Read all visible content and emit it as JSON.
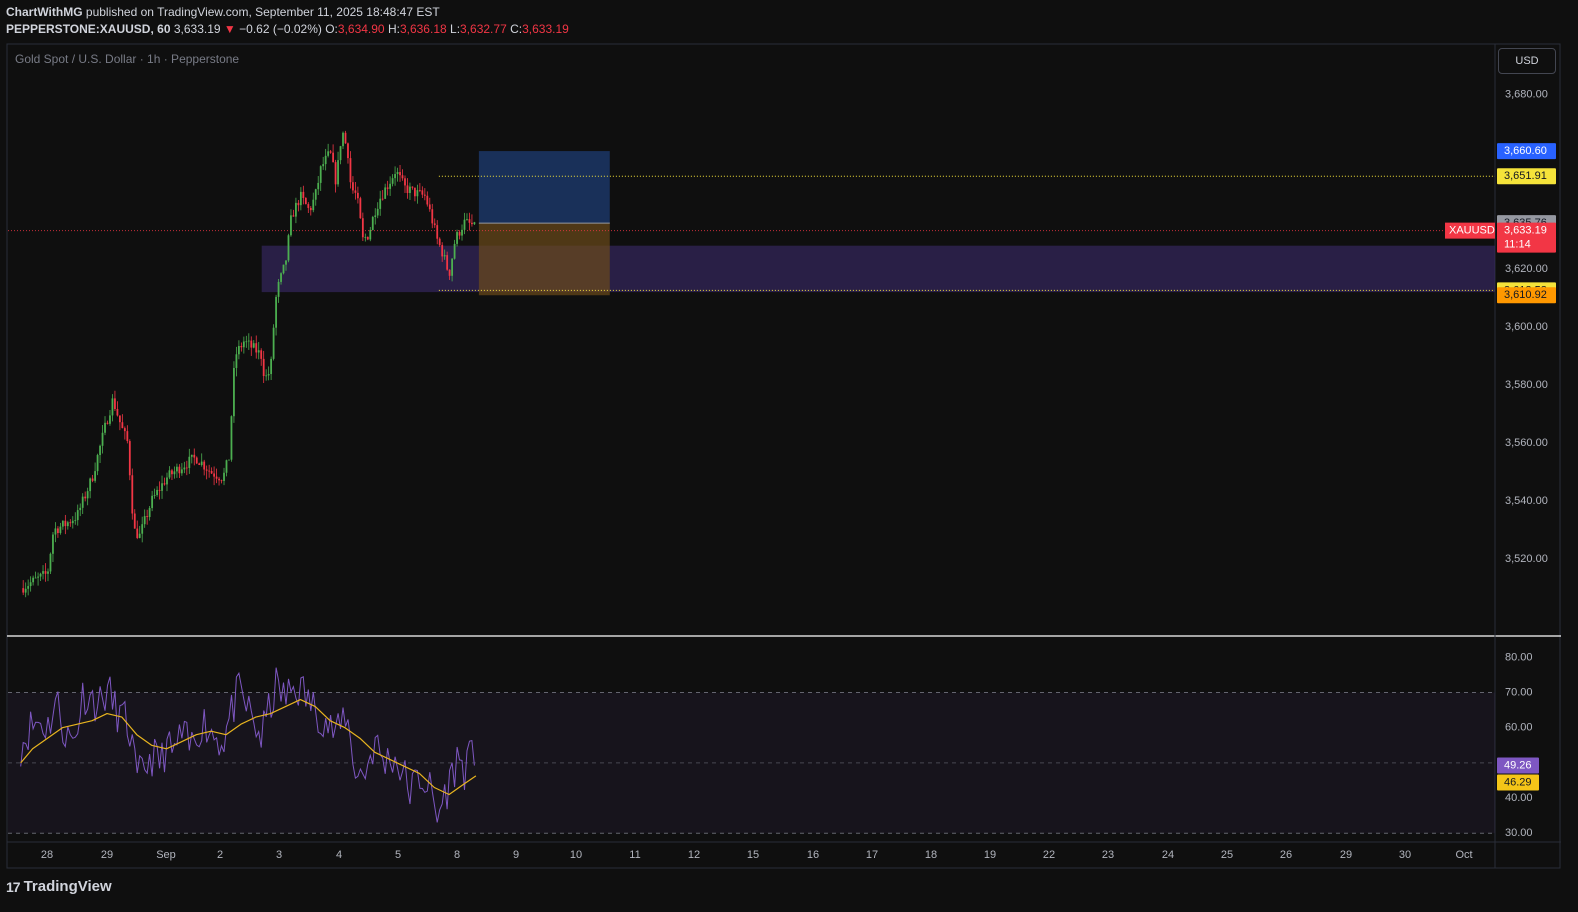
{
  "header": {
    "author": "ChartWithMG",
    "published_text": "published on TradingView.com, September 11, 2025 18:48:47 EST",
    "symbol": "PEPPERSTONE:XAUUSD, 60",
    "last": "3,633.19",
    "change_arrow": "▼",
    "change": "−0.62 (−0.02%)",
    "o_label": "O:",
    "o_value": "3,634.90",
    "h_label": "H:",
    "h_value": "3,636.18",
    "l_label": "L:",
    "l_value": "3,632.77",
    "c_label": "C:",
    "c_value": "3,633.19"
  },
  "currency_button": "USD",
  "brand": {
    "mark": "17",
    "name": "TradingView"
  },
  "colors": {
    "background": "#0f0f0f",
    "up": "#26a69a",
    "up_bright": "#4caf50",
    "down": "#f23645",
    "rsi_line": "#7e57c2",
    "rsi_ma": "#e8b41f",
    "zone": "#3b2a6b",
    "target": "#1b3666",
    "stop": "#6b4a1a"
  },
  "chart_data": [
    {
      "type": "candlestick",
      "title": "Gold Spot / U.S. Dollar · 1h · Pepperstone",
      "y_ticks": [
        "3,520.00",
        "3,540.00",
        "3,560.00",
        "3,580.00",
        "3,600.00",
        "3,620.00",
        "3,680.00"
      ],
      "y_tick_values": [
        3520,
        3540,
        3560,
        3580,
        3600,
        3620,
        3680
      ],
      "ylim": [
        3493.5,
        3697.5
      ],
      "x_tick_labels": [
        "28",
        "29",
        "Sep",
        "2",
        "3",
        "4",
        "5",
        "8",
        "9",
        "10",
        "11",
        "12",
        "15",
        "16",
        "17",
        "18",
        "19",
        "22",
        "23",
        "24",
        "25",
        "26",
        "29",
        "30",
        "Oct"
      ],
      "price_path": [
        [
          -0.45,
          3510
        ],
        [
          0,
          3515
        ],
        [
          0.1,
          3530
        ],
        [
          0.3,
          3532
        ],
        [
          0.5,
          3535
        ],
        [
          0.75,
          3548
        ],
        [
          1,
          3568
        ],
        [
          1.1,
          3575
        ],
        [
          1.25,
          3565
        ],
        [
          1.35,
          3560
        ],
        [
          1.45,
          3530
        ],
        [
          1.55,
          3528
        ],
        [
          1.75,
          3540
        ],
        [
          2,
          3548
        ],
        [
          2.25,
          3552
        ],
        [
          2.5,
          3555
        ],
        [
          2.75,
          3550
        ],
        [
          2.95,
          3548
        ],
        [
          3.05,
          3555
        ],
        [
          3.15,
          3590
        ],
        [
          3.3,
          3595
        ],
        [
          3.5,
          3592
        ],
        [
          3.6,
          3590
        ],
        [
          3.65,
          3582
        ],
        [
          3.75,
          3585
        ],
        [
          3.8,
          3600
        ],
        [
          3.85,
          3612
        ],
        [
          4,
          3622
        ],
        [
          4.1,
          3638
        ],
        [
          4.25,
          3645
        ],
        [
          4.4,
          3640
        ],
        [
          4.5,
          3645
        ],
        [
          4.6,
          3655
        ],
        [
          4.75,
          3660
        ],
        [
          4.85,
          3650
        ],
        [
          4.95,
          3668
        ],
        [
          5.05,
          3660
        ],
        [
          5.1,
          3648
        ],
        [
          5.2,
          3645
        ],
        [
          5.3,
          3630
        ],
        [
          5.4,
          3632
        ],
        [
          5.5,
          3640
        ],
        [
          5.6,
          3645
        ],
        [
          5.75,
          3650
        ],
        [
          5.85,
          3654
        ],
        [
          6,
          3648
        ],
        [
          6.2,
          3646
        ],
        [
          6.35,
          3645
        ],
        [
          6.45,
          3638
        ],
        [
          6.55,
          3630
        ],
        [
          6.65,
          3625
        ],
        [
          6.75,
          3618
        ],
        [
          6.85,
          3630
        ],
        [
          7,
          3636
        ],
        [
          7.15,
          3635
        ],
        [
          7.2,
          3633.19
        ]
      ],
      "last_price": 3633.19,
      "price_labels": [
        {
          "text": "3,660.60",
          "value": 3660.6,
          "bg": "#2962ff",
          "fg": "#ffffff"
        },
        {
          "text": "3,651.91",
          "value": 3651.91,
          "bg": "#f5e33a",
          "fg": "#131722"
        },
        {
          "text": "3,635.76",
          "value": 3635.76,
          "bg": "#9598a1",
          "fg": "#131722"
        },
        {
          "text": "3,633.19",
          "value": 3633.19,
          "bg": "#f23645",
          "fg": "#ffffff"
        },
        {
          "text": "11:14",
          "value": 3633.19,
          "bg": "#f23645",
          "fg": "#ffffff"
        },
        {
          "text": "3,612.58",
          "value": 3612.58,
          "bg": "#f5e33a",
          "fg": "#131722"
        },
        {
          "text": "3,610.92",
          "value": 3610.92,
          "bg": "#ff9800",
          "fg": "#131722"
        }
      ],
      "symbol_tag": "XAUUSD",
      "demand_zone": {
        "from_day": 3.6,
        "to_day": 24.3,
        "low": 3612,
        "high": 3628
      },
      "position": {
        "from_day": 7.25,
        "to_day": 9.45,
        "target": 3660.6,
        "entry": 3635.76,
        "stop": 3610.92
      },
      "levels": [
        {
          "value": 3651.91,
          "from_day": 7.25,
          "color": "#f5e33a"
        },
        {
          "value": 3612.58,
          "from_day": 7.25,
          "color": "#f5e33a"
        }
      ]
    },
    {
      "type": "line",
      "title": "",
      "y_ticks": [
        "30.00",
        "40.00",
        "60.00",
        "70.00",
        "80.00"
      ],
      "y_tick_values": [
        30,
        40,
        60,
        70,
        80
      ],
      "ylim": [
        27.5,
        85.5
      ],
      "bands": {
        "upper": 70,
        "middle": 50,
        "lower": 30
      },
      "rsi_path": [
        [
          -0.45,
          55
        ],
        [
          -0.3,
          60
        ],
        [
          -0.15,
          62
        ],
        [
          0,
          60
        ],
        [
          0.15,
          68
        ],
        [
          0.3,
          58
        ],
        [
          0.45,
          56
        ],
        [
          0.6,
          70
        ],
        [
          0.75,
          68
        ],
        [
          0.9,
          67
        ],
        [
          1,
          71
        ],
        [
          1.15,
          65
        ],
        [
          1.3,
          62
        ],
        [
          1.4,
          58
        ],
        [
          1.5,
          44
        ],
        [
          1.6,
          48
        ],
        [
          1.75,
          52
        ],
        [
          1.9,
          50
        ],
        [
          2,
          55
        ],
        [
          2.1,
          52
        ],
        [
          2.25,
          58
        ],
        [
          2.4,
          54
        ],
        [
          2.6,
          62
        ],
        [
          2.8,
          58
        ],
        [
          2.95,
          56
        ],
        [
          3.05,
          62
        ],
        [
          3.2,
          70
        ],
        [
          3.35,
          66
        ],
        [
          3.5,
          60
        ],
        [
          3.6,
          57
        ],
        [
          3.7,
          64
        ],
        [
          3.85,
          72
        ],
        [
          4,
          68
        ],
        [
          4.15,
          72
        ],
        [
          4.3,
          70
        ],
        [
          4.45,
          66
        ],
        [
          4.6,
          64
        ],
        [
          4.75,
          60
        ],
        [
          4.9,
          58
        ],
        [
          5,
          65
        ],
        [
          5.1,
          56
        ],
        [
          5.2,
          46
        ],
        [
          5.35,
          48
        ],
        [
          5.5,
          56
        ],
        [
          5.65,
          50
        ],
        [
          5.8,
          52
        ],
        [
          5.95,
          48
        ],
        [
          6.1,
          42
        ],
        [
          6.25,
          46
        ],
        [
          6.4,
          44
        ],
        [
          6.55,
          34
        ],
        [
          6.65,
          40
        ],
        [
          6.75,
          44
        ],
        [
          6.9,
          52
        ],
        [
          7,
          48
        ],
        [
          7.15,
          52
        ],
        [
          7.2,
          49.26
        ]
      ],
      "ma_path": [
        [
          -0.45,
          50
        ],
        [
          -0.25,
          54
        ],
        [
          0,
          57
        ],
        [
          0.25,
          60
        ],
        [
          0.5,
          61
        ],
        [
          0.75,
          62
        ],
        [
          1,
          64
        ],
        [
          1.25,
          63
        ],
        [
          1.5,
          58
        ],
        [
          1.75,
          55
        ],
        [
          2,
          54
        ],
        [
          2.25,
          56
        ],
        [
          2.5,
          58
        ],
        [
          2.75,
          59
        ],
        [
          3,
          58
        ],
        [
          3.25,
          61
        ],
        [
          3.5,
          63
        ],
        [
          3.75,
          64
        ],
        [
          4,
          66
        ],
        [
          4.25,
          68
        ],
        [
          4.5,
          66
        ],
        [
          4.75,
          62
        ],
        [
          5,
          60
        ],
        [
          5.25,
          57
        ],
        [
          5.5,
          53
        ],
        [
          5.75,
          51
        ],
        [
          6,
          49
        ],
        [
          6.25,
          47
        ],
        [
          6.5,
          43
        ],
        [
          6.75,
          41
        ],
        [
          7,
          44
        ],
        [
          7.2,
          46.29
        ]
      ],
      "last_rsi": {
        "text": "49.26",
        "value": 49.26,
        "bg": "#7e57c2",
        "fg": "#ffffff"
      },
      "last_ma": {
        "text": "46.29",
        "value": 46.29,
        "bg": "#f5c518",
        "fg": "#131722"
      }
    }
  ]
}
